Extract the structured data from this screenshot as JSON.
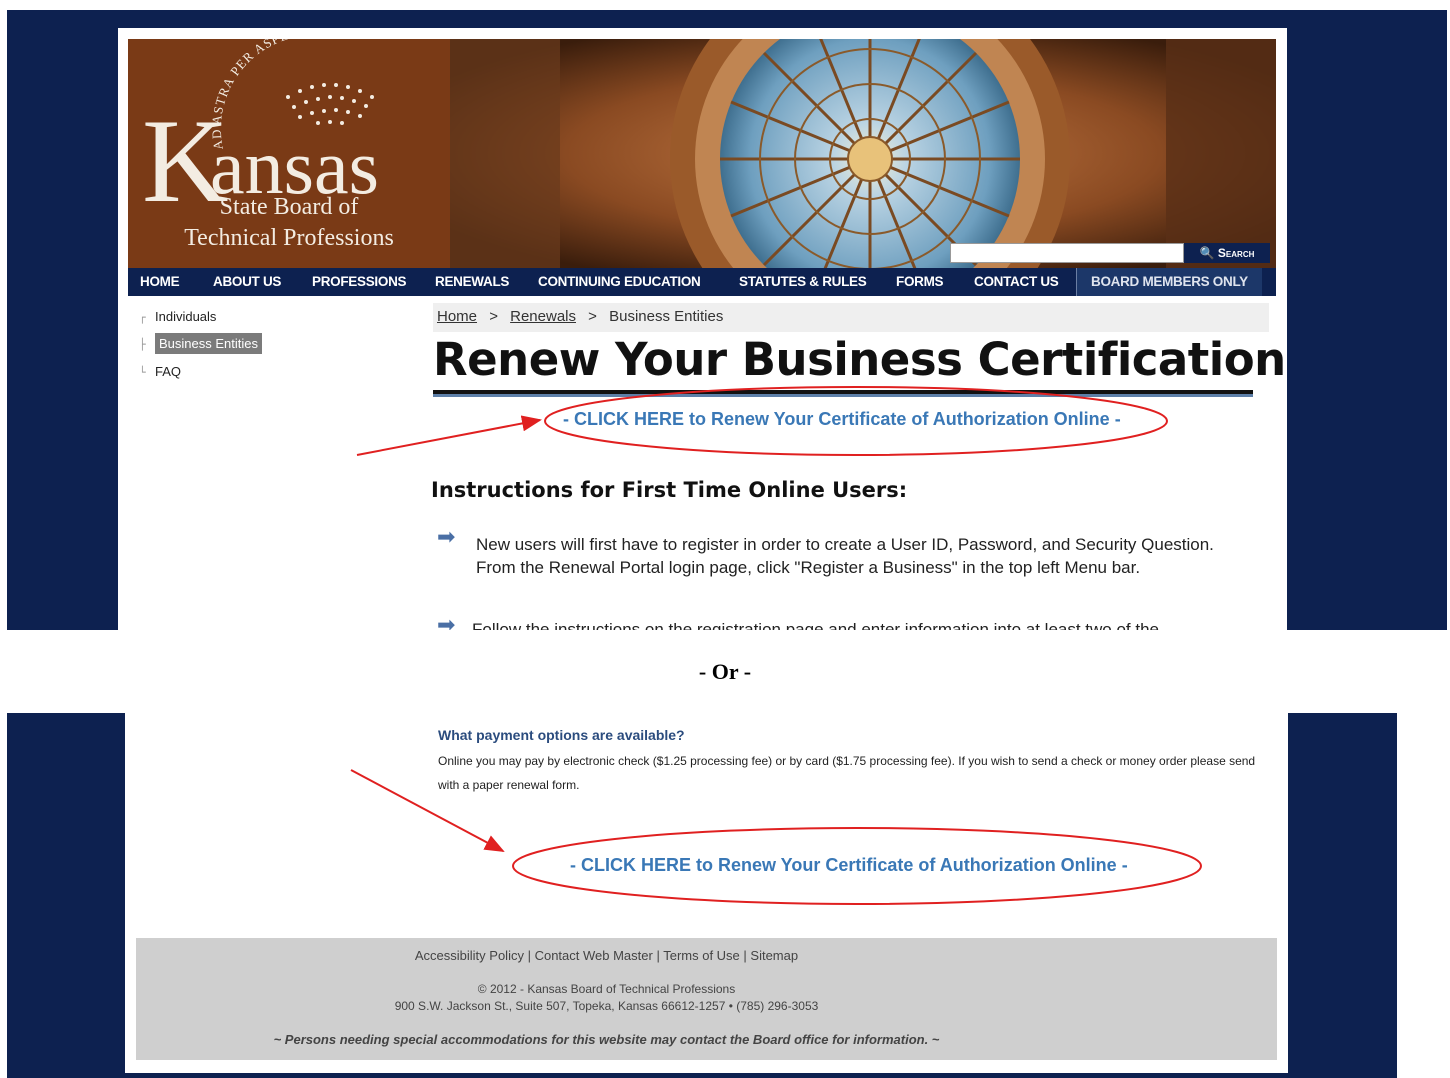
{
  "top_panel": {
    "logo": {
      "motto": "AD ASTRA PER ASPERA",
      "word_k": "K",
      "word_rest": "ansas",
      "line1": "State Board of",
      "line2": "Technical Professions"
    },
    "search": {
      "button_label": "Search",
      "value": ""
    },
    "nav": [
      "HOME",
      "ABOUT US",
      "PROFESSIONS",
      "RENEWALS",
      "CONTINUING EDUCATION",
      "STATUTES & RULES",
      "FORMS",
      "CONTACT US",
      "BOARD MEMBERS ONLY"
    ],
    "subnav": [
      "Individuals",
      "Business Entities",
      "FAQ"
    ],
    "breadcrumb": {
      "home": "Home",
      "sep": ">",
      "renewals": "Renewals",
      "current": "Business Entities"
    },
    "title": "Renew Your Business Certification",
    "renew_link": "- CLICK HERE to Renew Your Certificate of Authorization Online -",
    "instructions_heading": "Instructions for First Time Online Users:",
    "bullets": [
      "New users will first have to register in order to create a User ID, Password, and Security Question. From the Renewal Portal login page, click \"Register a Business\" in the top left Menu bar.",
      "Follow the instructions on the registration page and enter information into at least two of the"
    ]
  },
  "separator": "- Or -",
  "bottom_panel": {
    "payment_question": "What payment options are available?",
    "payment_answer": "Online you may pay by electronic check ($1.25 processing fee) or by card ($1.75 processing fee). If you wish to send a check or money order please send with a paper renewal form.",
    "renew_link": "- CLICK HERE to Renew Your Certificate of Authorization Online -",
    "footer": {
      "links": [
        "Accessibility Policy",
        "Contact Web Master",
        "Terms of Use",
        "Sitemap"
      ],
      "copyright": "© 2012 - Kansas Board of Technical Professions",
      "address": "900 S.W. Jackson St., Suite 507, Topeka, Kansas 66612-1257 • (785) 296-3053",
      "note": "~ Persons needing special accommodations for this website may contact the Board office for information. ~"
    }
  },
  "colors": {
    "navy": "#0d2150",
    "logo_brown": "#7a3a16",
    "link_blue": "#3a78b6",
    "annotation_red": "#e02020"
  }
}
